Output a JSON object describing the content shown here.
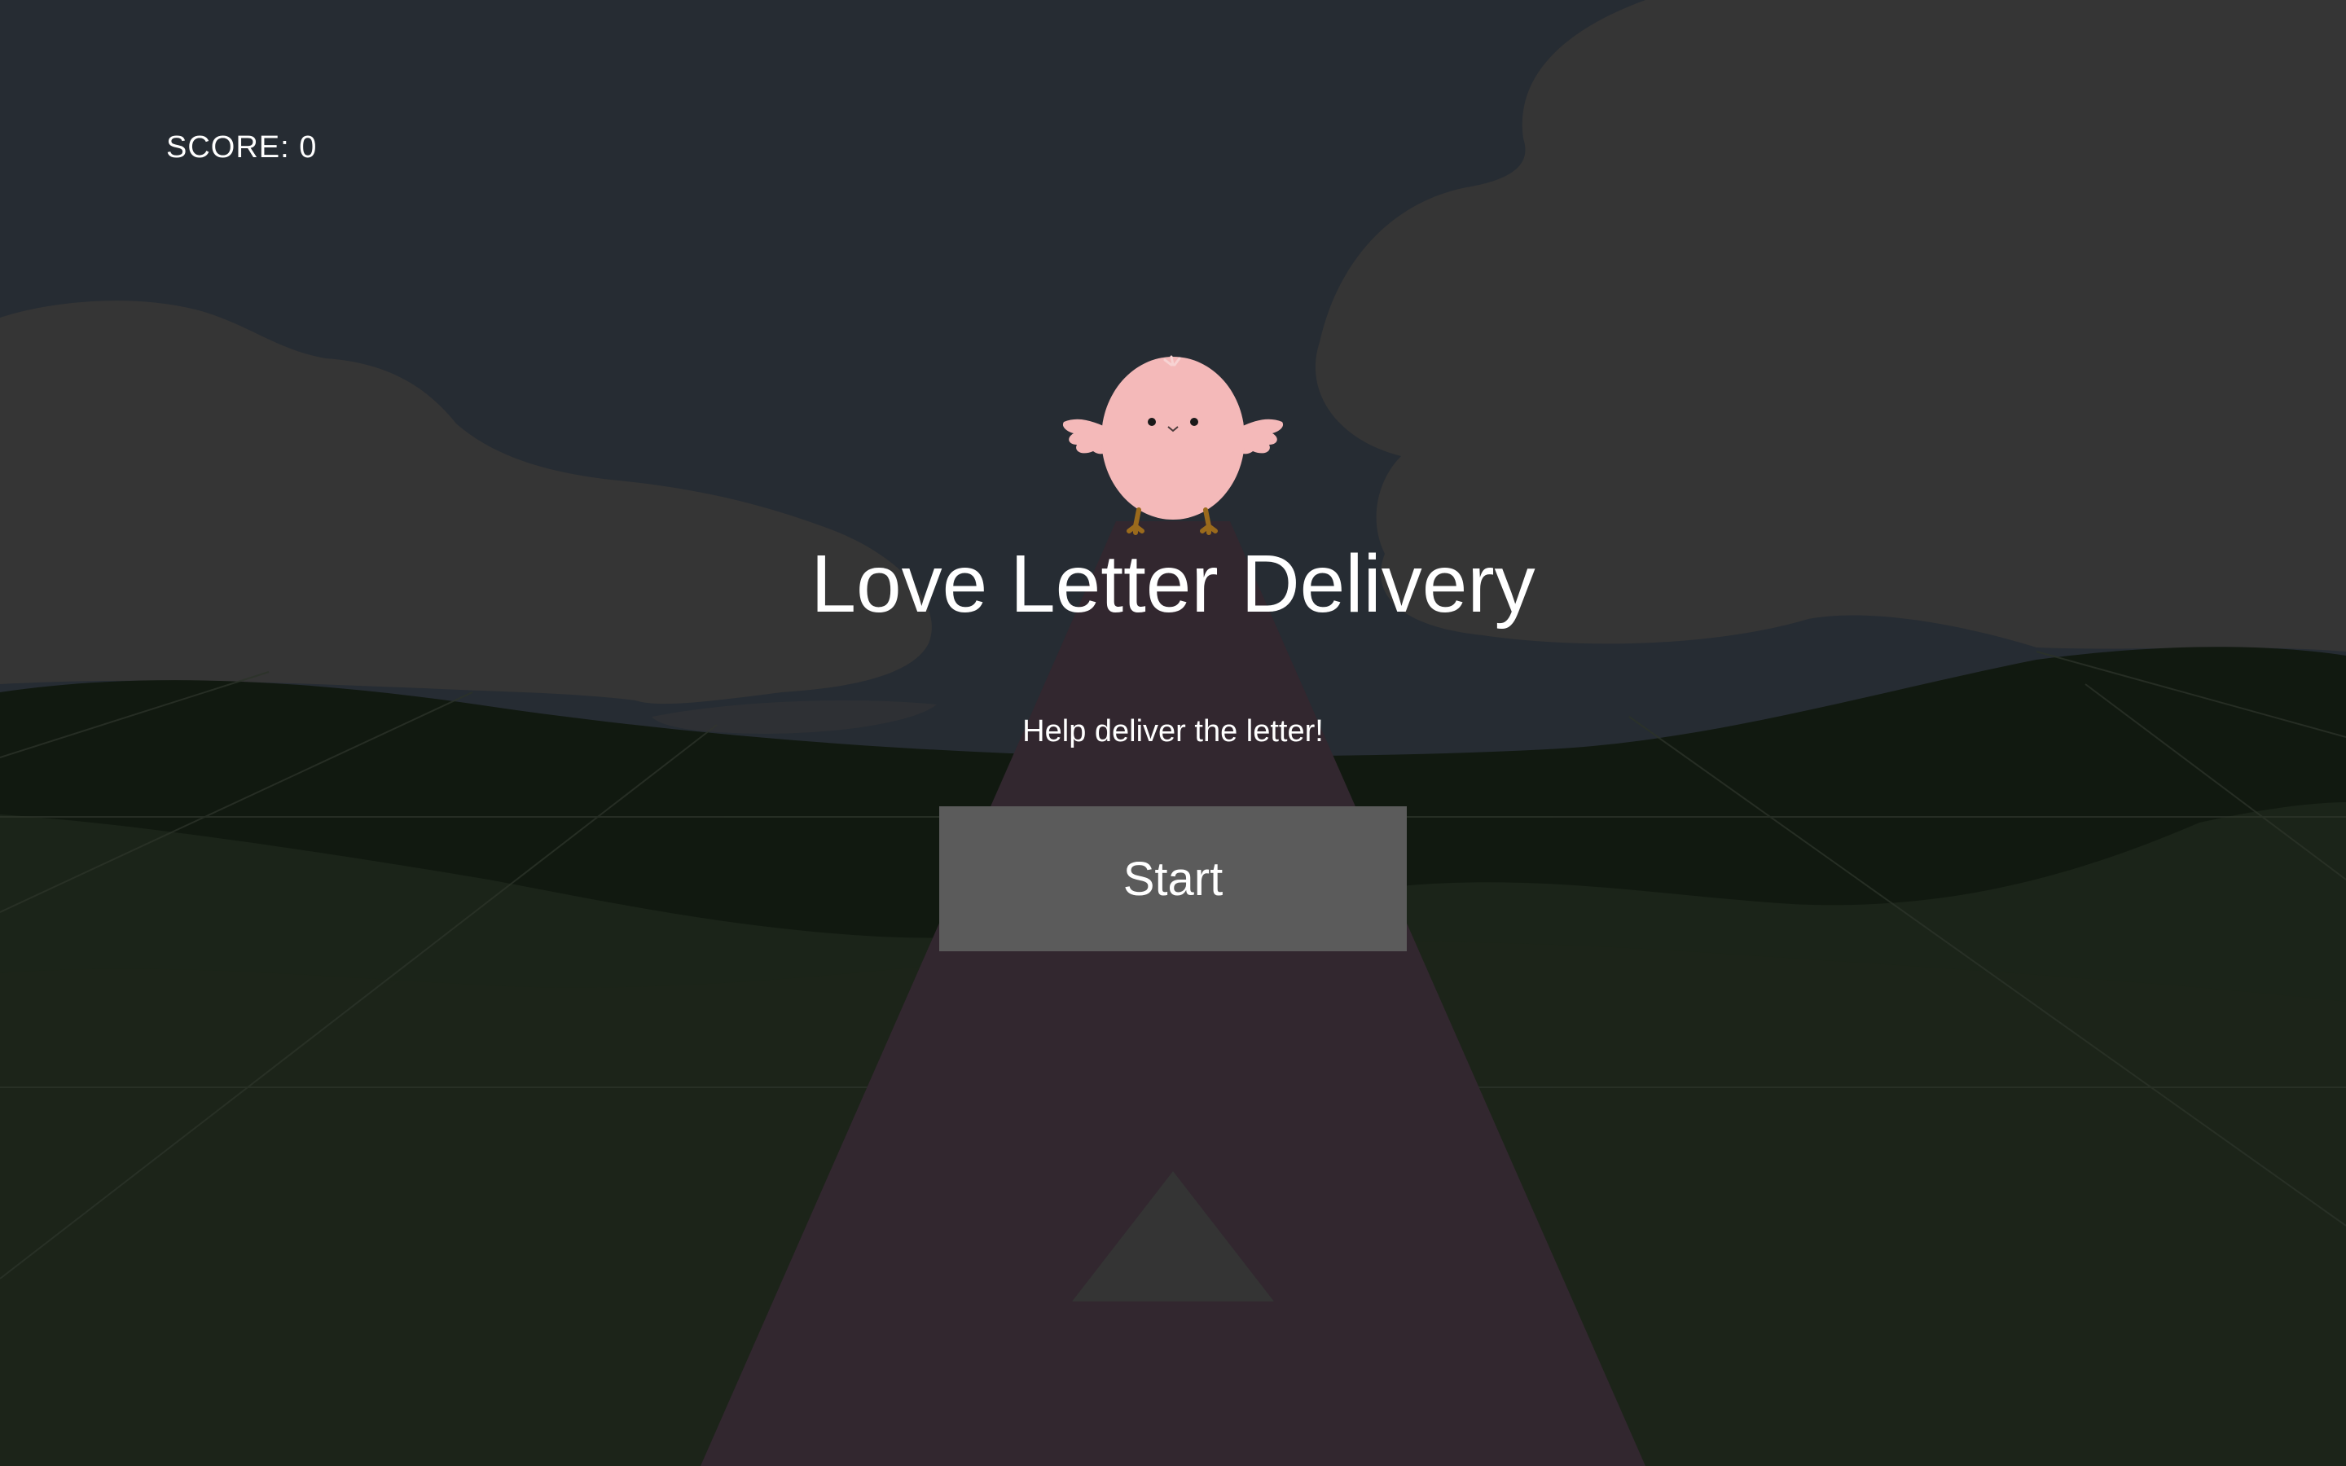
{
  "hud": {
    "score_text": "SCORE: 0"
  },
  "menu": {
    "title": "Love Letter Delivery",
    "subtitle": "Help deliver the letter!",
    "start_label": "Start"
  },
  "colors": {
    "sky": "#262c33",
    "cloud": "#353535",
    "hill_far": "#111910",
    "hill_near": "#1b2419",
    "ground": "#1c2419",
    "road": "#32272f",
    "bird_body": "#f4b9b9",
    "bird_feet": "#9a6a1c",
    "button": "#5b5b5b",
    "arrow": "#343434",
    "text": "#ffffff"
  },
  "icons": {
    "bird": "pink-chick-icon",
    "arrow": "up-arrow-icon"
  }
}
